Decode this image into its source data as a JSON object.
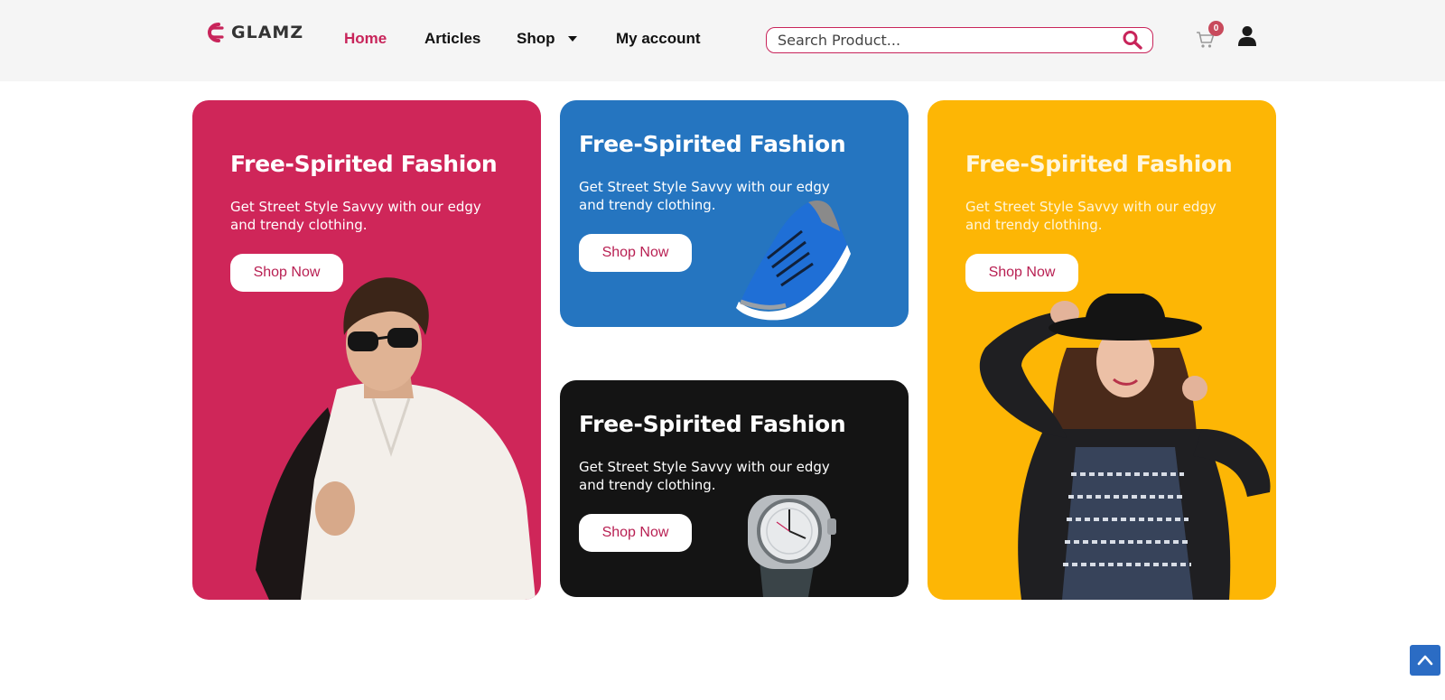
{
  "brand": {
    "name": "GLAMZ",
    "color": "#c8245a"
  },
  "nav": {
    "items": [
      {
        "label": "Home",
        "active": true
      },
      {
        "label": "Articles",
        "active": false
      },
      {
        "label": "Shop",
        "active": false,
        "has_dropdown": true
      },
      {
        "label": "My account",
        "active": false
      }
    ]
  },
  "search": {
    "placeholder": "Search Product...",
    "value": "",
    "icon": "search-icon"
  },
  "cart": {
    "count": "0",
    "icon": "cart-icon"
  },
  "user": {
    "icon": "user-icon"
  },
  "cards": [
    {
      "title": "Free-Spirited Fashion",
      "text": "Get Street Style Savvy with our edgy and trendy clothing.",
      "button": "Shop Now",
      "background": "#cf2659",
      "image": "man-in-sunglasses"
    },
    {
      "title": "Free-Spirited Fashion",
      "text": "Get Street Style Savvy with our edgy and trendy clothing.",
      "button": "Shop Now",
      "background": "#2575c0",
      "image": "blue-sneaker"
    },
    {
      "title": "Free-Spirited Fashion",
      "text": "Get Street Style Savvy with our edgy and trendy clothing.",
      "button": "Shop Now",
      "background": "#141414",
      "image": "wristwatch"
    },
    {
      "title": "Free-Spirited Fashion",
      "text": "Get Street Style Savvy with our edgy and trendy clothing.",
      "button": "Shop Now",
      "background": "#fdb605",
      "image": "woman-in-hat"
    }
  ],
  "scroll_top": {
    "icon": "chevron-up-icon",
    "color": "#2b6cc4"
  }
}
